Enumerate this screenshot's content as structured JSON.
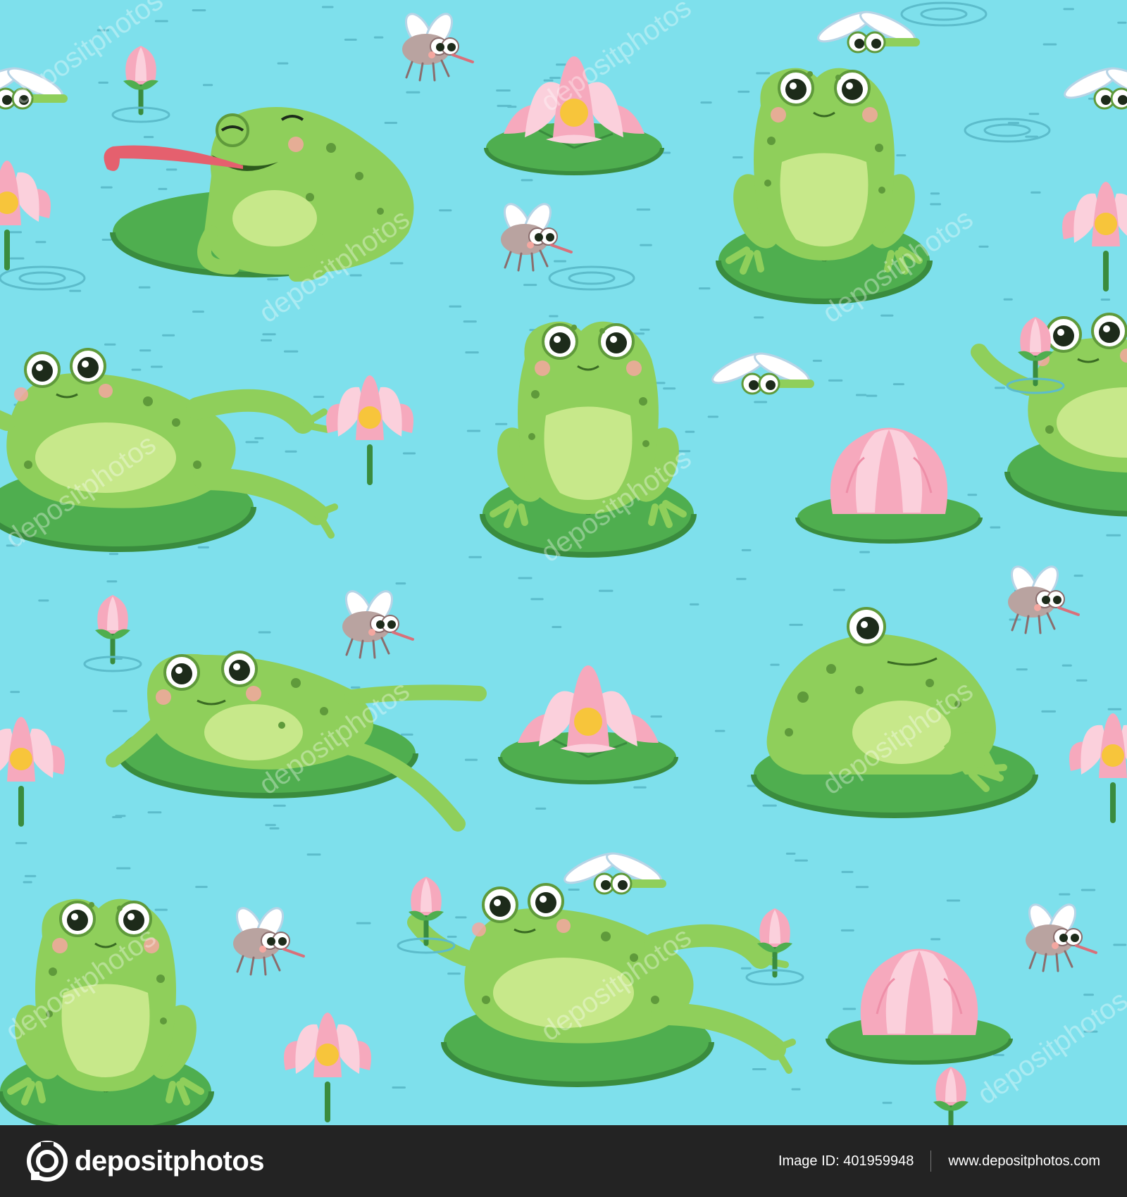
{
  "footer": {
    "logo_text": "depositphotos",
    "image_id": "Image ID: 401959948",
    "site_url": "www.depositphotos.com"
  },
  "watermark_text": "depositphotos",
  "colors": {
    "water": "#7ee0ec",
    "frog_green": "#8fcf5b",
    "frog_dark": "#5f9a3b",
    "frog_belly": "#c7e88a",
    "lily_pad": "#4fae4f",
    "lily_pad_dark": "#3a8c3e",
    "lotus_pink": "#f6a9bd",
    "lotus_light": "#fbd0dc",
    "lotus_center": "#f7c53b",
    "footer_bg": "#232323"
  },
  "icons": [
    "camera-logo-icon"
  ]
}
